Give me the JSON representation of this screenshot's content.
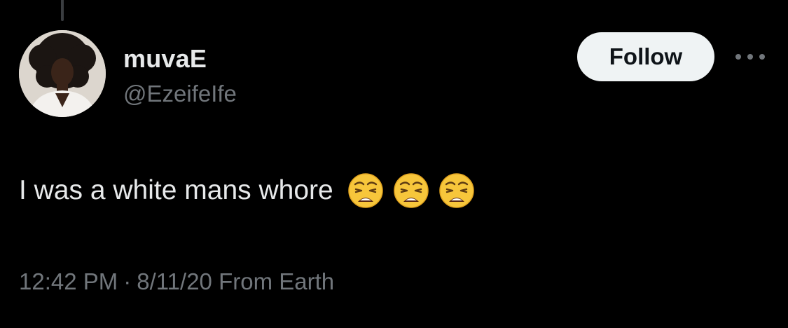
{
  "author": {
    "display_name": "muvaE",
    "handle": "@EzeifeIfe",
    "avatar_icon": "profile-photo"
  },
  "actions": {
    "follow_label": "Follow",
    "more_icon": "more-horizontal-icon"
  },
  "tweet": {
    "text": "I was a white mans whore",
    "emojis": [
      "weary-face",
      "weary-face",
      "weary-face"
    ]
  },
  "meta": {
    "time": "12:42 PM",
    "separator": "·",
    "date": "8/11/20",
    "source": "From Earth"
  },
  "colors": {
    "background": "#000000",
    "primary_text": "#e7e9ea",
    "secondary_text": "#71767b",
    "follow_bg": "#eff3f4",
    "follow_text": "#0f1419"
  }
}
